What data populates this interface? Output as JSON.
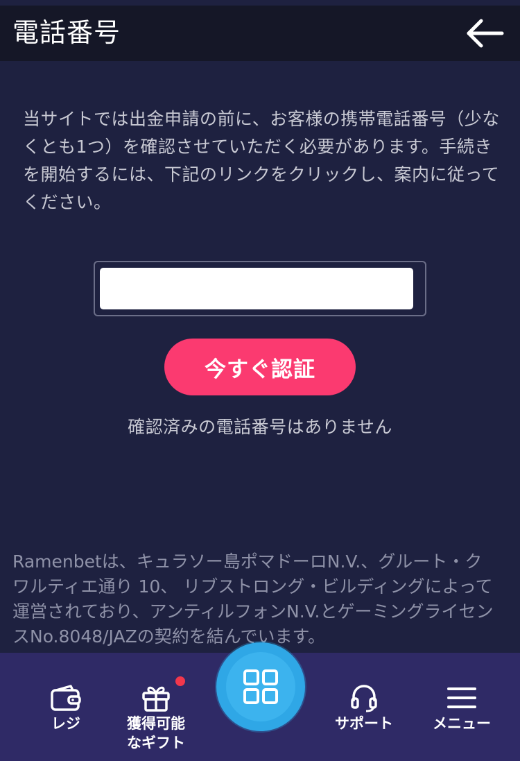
{
  "header": {
    "title": "電話番号",
    "back_icon": "arrow-left-icon"
  },
  "main": {
    "description": "当サイトでは出金申請の前に、お客様の携帯電話番号（少なくとも1つ）を確認させていただく必要があります。手続きを開始するには、下記のリンクをクリックし、案内に従ってください。",
    "phone_input": {
      "value": "",
      "placeholder": ""
    },
    "verify_button_label": "今すぐ認証",
    "verify_button_color": "#fb3a70",
    "no_phone_message": "確認済みの電話番号はありません"
  },
  "footer": {
    "legal_text": "Ramenbetは、キュラソー島ポマドーロN.V.、グルート・クワルティエ通り 10、 リブストロング・ビルディングによって運営されており、アンティルフォンN.V.とゲーミングライセンスNo.8048/JAZの契約を結んでいます。"
  },
  "bottom_nav": {
    "items": [
      {
        "label": "レジ",
        "icon": "wallet-icon"
      },
      {
        "label": "獲得可能\nなギフト",
        "icon": "gift-icon",
        "has_notification": true
      },
      {
        "label": "",
        "icon": "grid-icon"
      },
      {
        "label": "サポート",
        "icon": "headset-icon"
      },
      {
        "label": "メニュー",
        "icon": "hamburger-menu-icon"
      }
    ]
  },
  "colors": {
    "background": "#1e2140",
    "header": "#151727",
    "nav_background": "#2f2a66",
    "accent_blue": "#2fa7e6",
    "notification_red": "#f2374c"
  }
}
